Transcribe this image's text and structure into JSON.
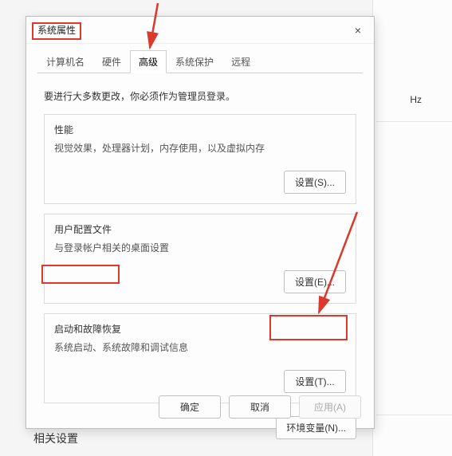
{
  "dialog": {
    "title": "系统属性",
    "close_icon": "×",
    "tabs": [
      {
        "label": "计算机名"
      },
      {
        "label": "硬件"
      },
      {
        "label": "高级",
        "active": true
      },
      {
        "label": "系统保护"
      },
      {
        "label": "远程"
      }
    ],
    "intro": "要进行大多数更改，你必须作为管理员登录。",
    "groups": {
      "perf": {
        "title": "性能",
        "desc": "视觉效果，处理器计划，内存使用，以及虚拟内存",
        "button": "设置(S)..."
      },
      "profile": {
        "title": "用户配置文件",
        "desc": "与登录帐户相关的桌面设置",
        "button": "设置(E)..."
      },
      "startup": {
        "title": "启动和故障恢复",
        "desc": "系统启动、系统故障和调试信息",
        "button": "设置(T)..."
      }
    },
    "env_button": "环境变量(N)...",
    "footer": {
      "ok": "确定",
      "cancel": "取消",
      "apply": "应用(A)"
    }
  },
  "background": {
    "hz_label": "Hz",
    "related_heading": "相关设置"
  },
  "annotations": {
    "arrow_color": "#d93a2b",
    "highlight_color": "#d93a2b"
  }
}
